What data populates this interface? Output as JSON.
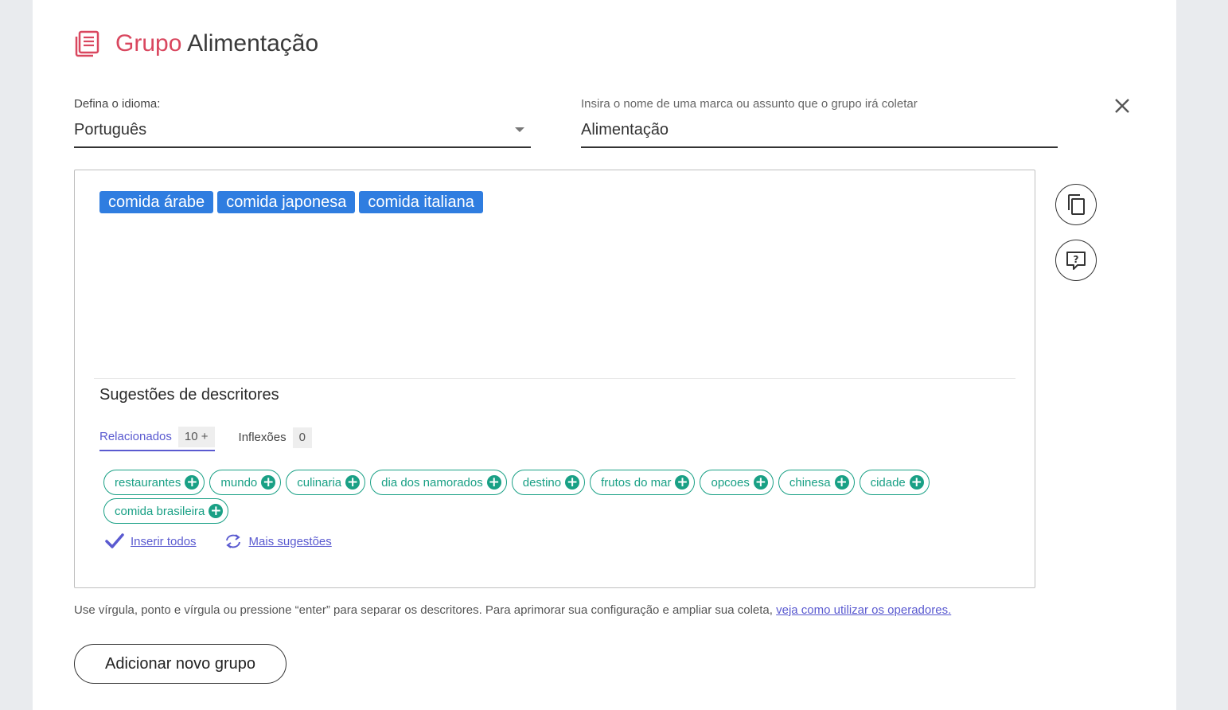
{
  "header": {
    "title_prefix": "Grupo",
    "title_name": "Alimentação",
    "icon": "newspaper-icon",
    "accent_color": "#d9475f"
  },
  "language_field": {
    "label": "Defina o idioma:",
    "value": "Português"
  },
  "subject_field": {
    "label": "Insira o nome de uma marca ou assunto que o grupo irá coletar",
    "value": "Alimentação"
  },
  "descriptors": [
    {
      "label": "comida árabe"
    },
    {
      "label": "comida japonesa"
    },
    {
      "label": "comida italiana"
    }
  ],
  "suggestions": {
    "title": "Sugestões de descritores",
    "tabs": [
      {
        "label": "Relacionados",
        "count": "10 +"
      },
      {
        "label": "Inflexões",
        "count": "0"
      }
    ],
    "items": [
      {
        "label": "restaurantes"
      },
      {
        "label": "mundo"
      },
      {
        "label": "culinaria"
      },
      {
        "label": "dia dos namorados"
      },
      {
        "label": "destino"
      },
      {
        "label": "frutos do mar"
      },
      {
        "label": "opcoes"
      },
      {
        "label": "chinesa"
      },
      {
        "label": "cidade"
      },
      {
        "label": "comida brasileira"
      }
    ],
    "insert_all": "Inserir todos",
    "more": "Mais sugestões"
  },
  "hint": {
    "text": "Use vírgula, ponto e vírgula ou pressione “enter” para separar os descritores. Para aprimorar sua configuração e ampliar sua coleta,",
    "link": "veja como utilizar os operadores."
  },
  "add_group_label": "Adicionar novo grupo",
  "colors": {
    "chip_blue": "#2f7de0",
    "suggestion_green": "#19a085",
    "link_purple": "#5a5ad0"
  }
}
